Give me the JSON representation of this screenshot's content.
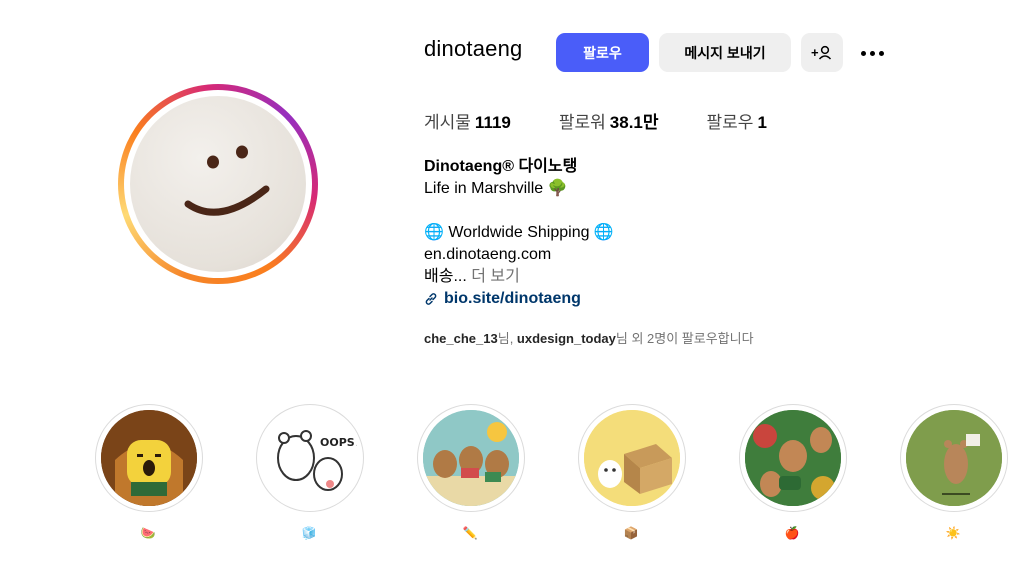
{
  "profile": {
    "username": "dinotaeng",
    "follow_label": "팔로우",
    "message_label": "메시지 보내기",
    "adduser_label": "+"
  },
  "stats": [
    {
      "label": "게시물",
      "value": "1119"
    },
    {
      "label": "팔로워",
      "value": "38.1만"
    },
    {
      "label": "팔로우",
      "value": "1"
    }
  ],
  "bio": {
    "name": "Dinotaeng® 다이노탱",
    "line1": "Life in Marshville 🌳",
    "line2": "🌐 Worldwide Shipping 🌐",
    "line3": "en.dinotaeng.com",
    "line4_prefix": "배송...",
    "more_label": "더 보기",
    "link": "bio.site/dinotaeng"
  },
  "followed_by": {
    "user1": "che_che_13",
    "sep1": "님, ",
    "user2": "uxdesign_today",
    "suffix": "님 외 2명이 팔로우합니다"
  },
  "highlights": [
    {
      "label": "🍉"
    },
    {
      "label": "🧊"
    },
    {
      "label": "✏️"
    },
    {
      "label": "📦"
    },
    {
      "label": "🍎"
    },
    {
      "label": "☀️"
    }
  ],
  "colors": {
    "accent": "#4a5df9",
    "link": "#00376b",
    "muted": "#737373"
  }
}
